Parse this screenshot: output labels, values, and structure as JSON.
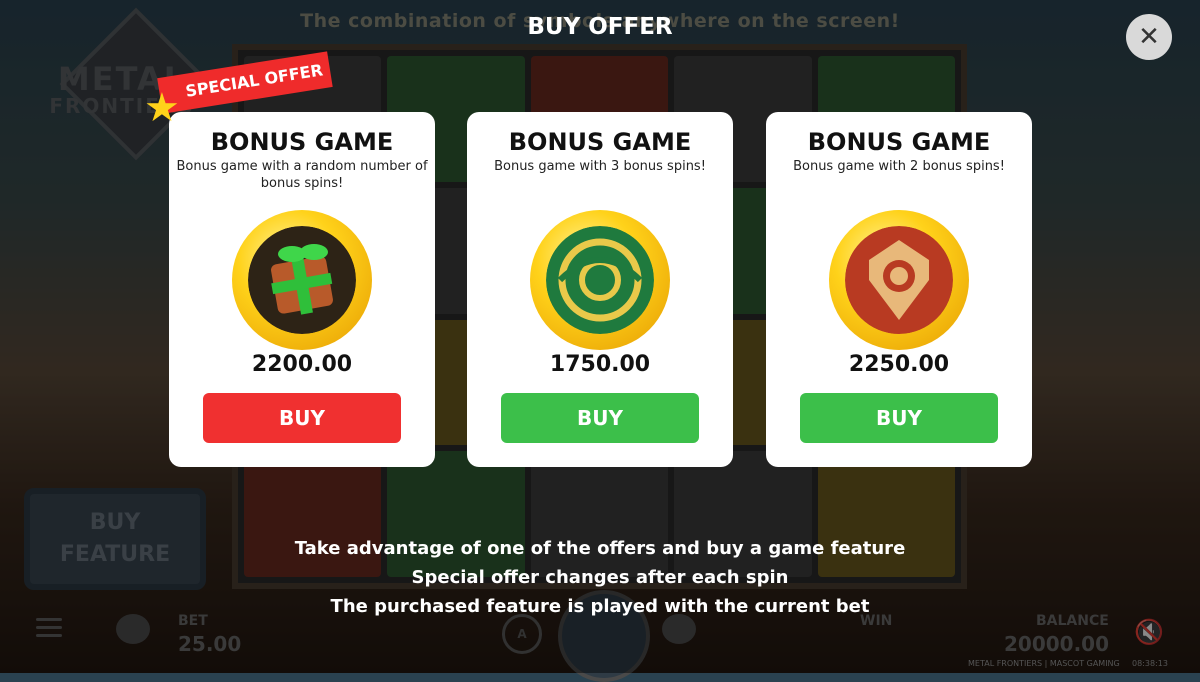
{
  "background": {
    "ticker_text": "The combination of symbols anywhere on the screen!",
    "logo_line1": "METAL",
    "logo_line2": "FRONTIERS",
    "buy_feature_line1": "BUY",
    "buy_feature_line2": "FEATURE",
    "bet_label": "BET",
    "bet_value": "25.00",
    "win_label": "WIN",
    "balance_label": "BALANCE",
    "balance_value": "20000.00",
    "auto_icon_text": "A",
    "footer_brand": "METAL FRONTIERS | MASCOT GAMING",
    "footer_time": "08:38:13"
  },
  "modal": {
    "title": "BUY OFFER",
    "close_icon": "close-icon",
    "special_label": "SPECIAL OFFER",
    "cards": [
      {
        "title": "BONUS GAME",
        "desc": "Bonus game with a random number of bonus spins!",
        "price": "2200.00",
        "buy_label": "BUY",
        "icon": "gift-icon",
        "button_color": "#f03030"
      },
      {
        "title": "BONUS GAME",
        "desc": "Bonus game with 3 bonus spins!",
        "price": "1750.00",
        "buy_label": "BUY",
        "icon": "green-emblem-icon",
        "button_color": "#3cbf4a"
      },
      {
        "title": "BONUS GAME",
        "desc": "Bonus game with 2 bonus spins!",
        "price": "2250.00",
        "buy_label": "BUY",
        "icon": "red-emblem-icon",
        "button_color": "#3cbf4a"
      }
    ],
    "notes": [
      "Take advantage of one of the offers and buy a game feature",
      "Special offer changes after each spin",
      "The purchased feature is played with the current bet"
    ]
  }
}
